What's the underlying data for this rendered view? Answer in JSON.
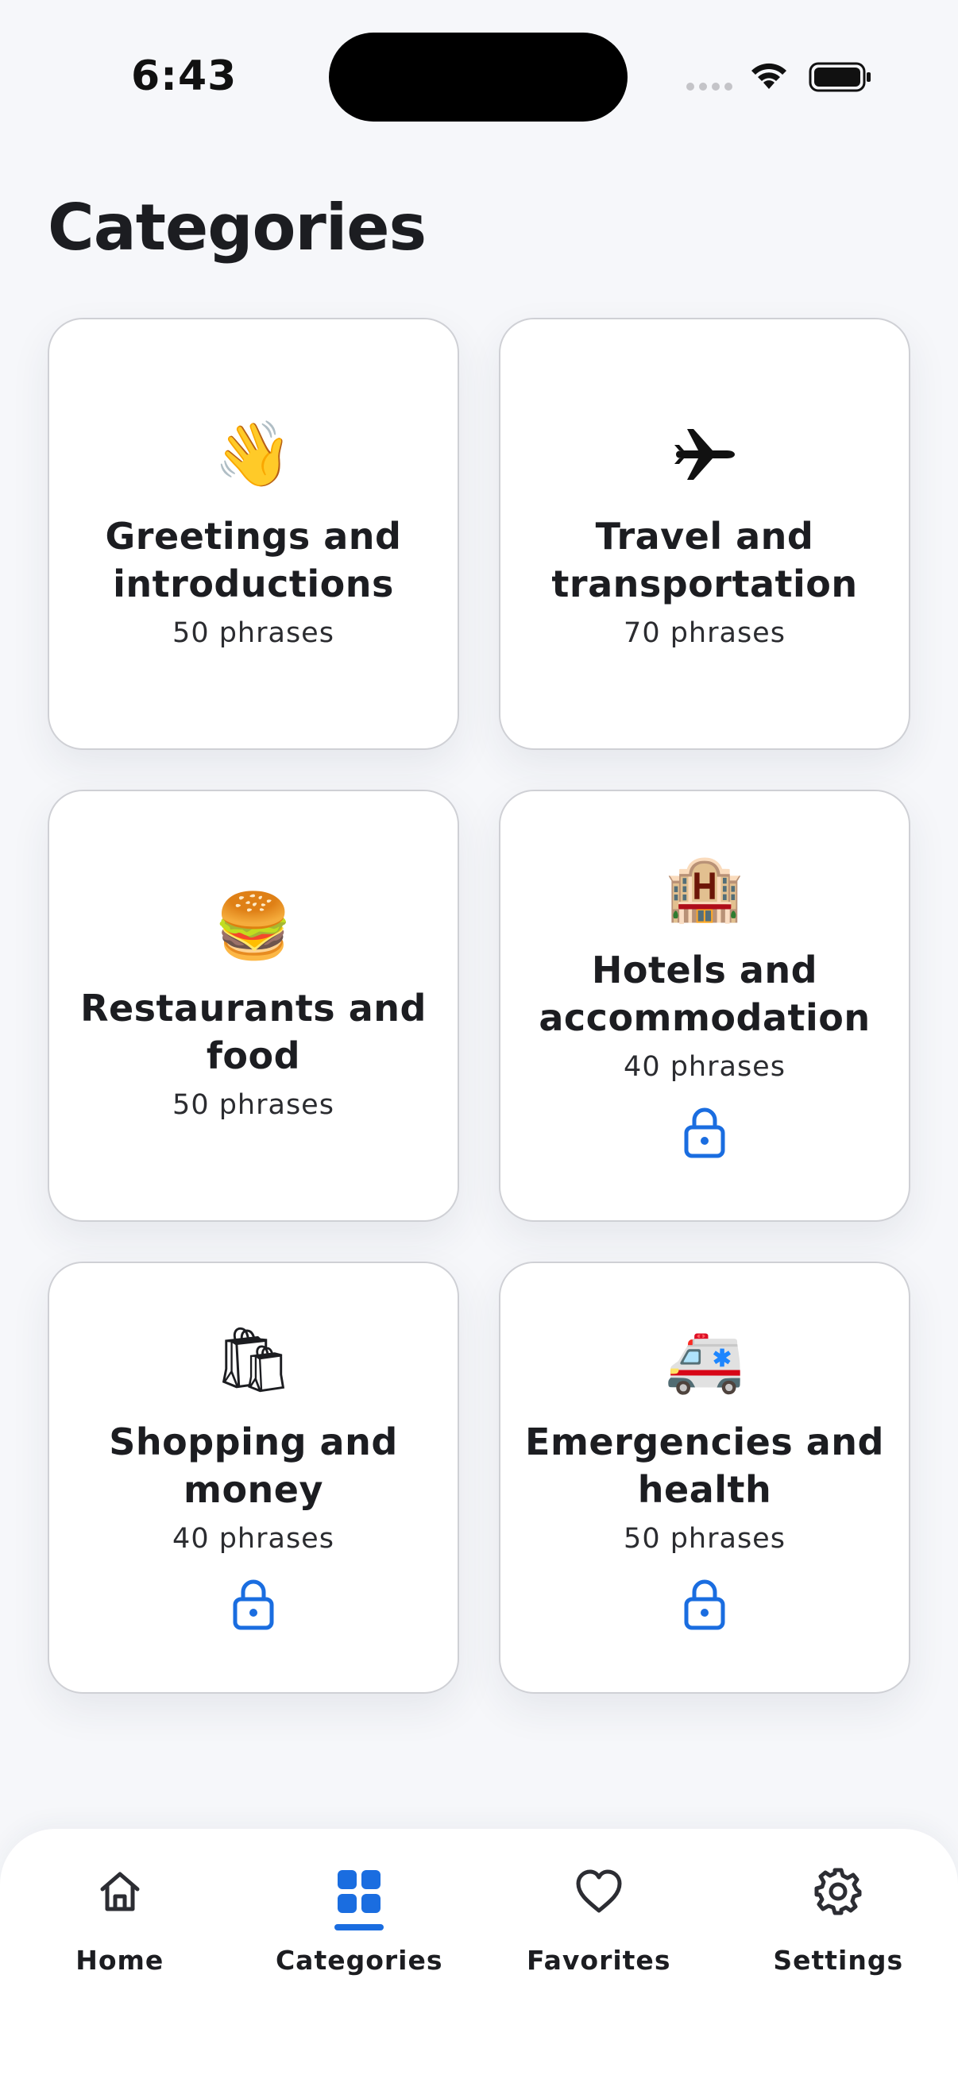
{
  "status_bar": {
    "time": "6:43"
  },
  "page": {
    "title": "Categories"
  },
  "categories": [
    {
      "emoji": "👋",
      "icon": "waving-hand-icon",
      "title": "Greetings and introductions",
      "count": "50 phrases",
      "locked": false
    },
    {
      "emoji": "✈",
      "icon": "airplane-icon",
      "title": "Travel and transportation",
      "count": "70 phrases",
      "locked": false
    },
    {
      "emoji": "🍔",
      "icon": "burger-icon",
      "title": "Restaurants and food",
      "count": "50 phrases",
      "locked": false
    },
    {
      "emoji": "🏨",
      "icon": "hotel-icon",
      "title": "Hotels and accommodation",
      "count": "40 phrases",
      "locked": true
    },
    {
      "emoji": "🛍",
      "icon": "shopping-bags-icon",
      "title": "Shopping and money",
      "count": "40 phrases",
      "locked": true
    },
    {
      "emoji": "🚑",
      "icon": "ambulance-icon",
      "title": "Emergencies and health",
      "count": "50 phrases",
      "locked": true
    }
  ],
  "tabs": [
    {
      "label": "Home",
      "icon": "home-icon",
      "active": false
    },
    {
      "label": "Categories",
      "icon": "grid-icon",
      "active": true
    },
    {
      "label": "Favorites",
      "icon": "heart-icon",
      "active": false
    },
    {
      "label": "Settings",
      "icon": "gear-icon",
      "active": false
    }
  ],
  "colors": {
    "accent": "#1a6de0",
    "background": "#f6f7fa",
    "card_border": "#cfd0d5",
    "text": "#1c1d21"
  }
}
